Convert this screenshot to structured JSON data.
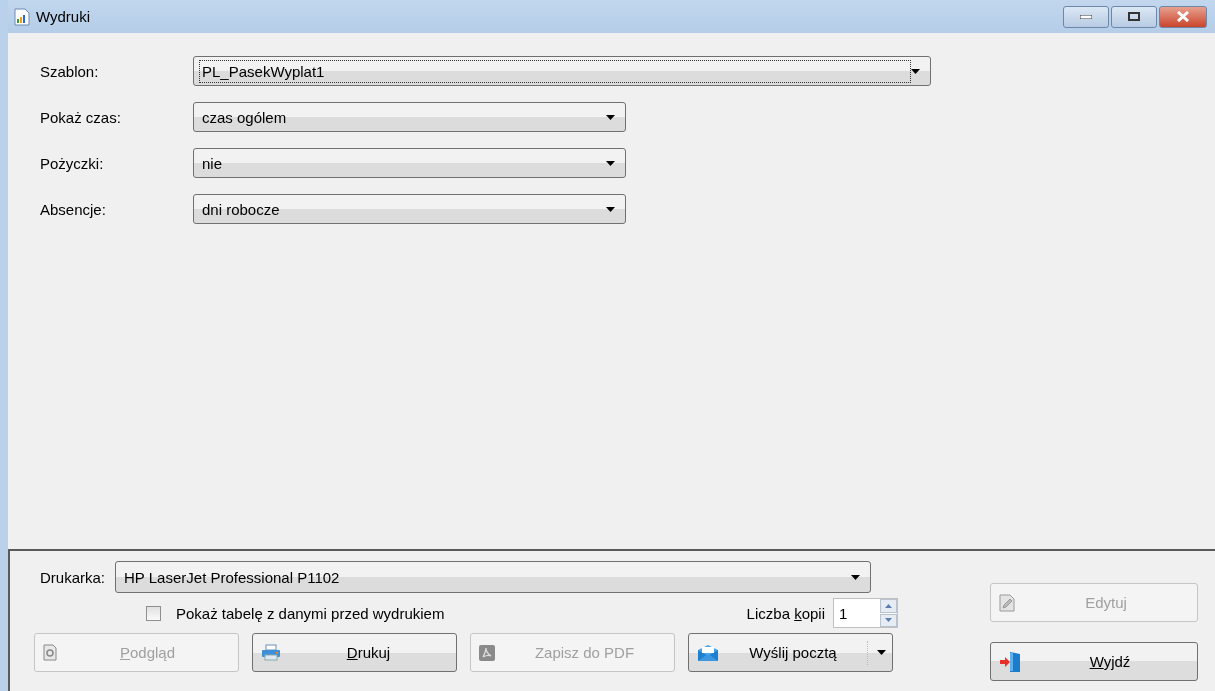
{
  "window": {
    "title": "Wydruki"
  },
  "fields": [
    {
      "label": "Szablon:",
      "value": "PL_PasekWyplat1",
      "kind": "wide",
      "focused": true
    },
    {
      "label": "Pokaż czas:",
      "value": "czas ogólem",
      "kind": "narrow",
      "focused": false
    },
    {
      "label": "Pożyczki:",
      "value": "nie",
      "kind": "narrow",
      "focused": false
    },
    {
      "label": "Absencje:",
      "value": "dni robocze",
      "kind": "narrow",
      "focused": false
    }
  ],
  "printer": {
    "label": "Drukarka:",
    "value": "HP LaserJet Professional P1102"
  },
  "show_table": {
    "label": "Pokaż tabelę z danymi przed wydrukiem",
    "checked": false
  },
  "copies": {
    "label": [
      {
        "text": "Liczba ",
        "underlined": false
      },
      {
        "text": "k",
        "underlined": true
      },
      {
        "text": "opii",
        "underlined": false
      }
    ],
    "value": "1"
  },
  "buttons": [
    {
      "label": [
        {
          "text": "P",
          "underlined": true
        },
        {
          "text": "odgląd",
          "underlined": false
        }
      ],
      "kind": "preview",
      "disabled": true
    },
    {
      "label": [
        {
          "text": "D",
          "underlined": true
        },
        {
          "text": "rukuj",
          "underlined": false
        }
      ],
      "kind": "print",
      "disabled": false
    },
    {
      "label": [
        {
          "text": "Zapisz do PDF",
          "underlined": false
        }
      ],
      "kind": "pdf",
      "disabled": true
    },
    {
      "label": [
        {
          "text": "Wyślij pocztą",
          "underlined": false
        }
      ],
      "kind": "mail",
      "disabled": false
    }
  ],
  "side_buttons": [
    {
      "label": [
        {
          "text": "Edytuj",
          "underlined": false
        }
      ],
      "kind": "edit",
      "disabled": true
    },
    {
      "label": [
        {
          "text": "W",
          "underlined": true
        },
        {
          "text": "yjdź",
          "underlined": false
        }
      ],
      "kind": "exit",
      "disabled": false
    }
  ]
}
